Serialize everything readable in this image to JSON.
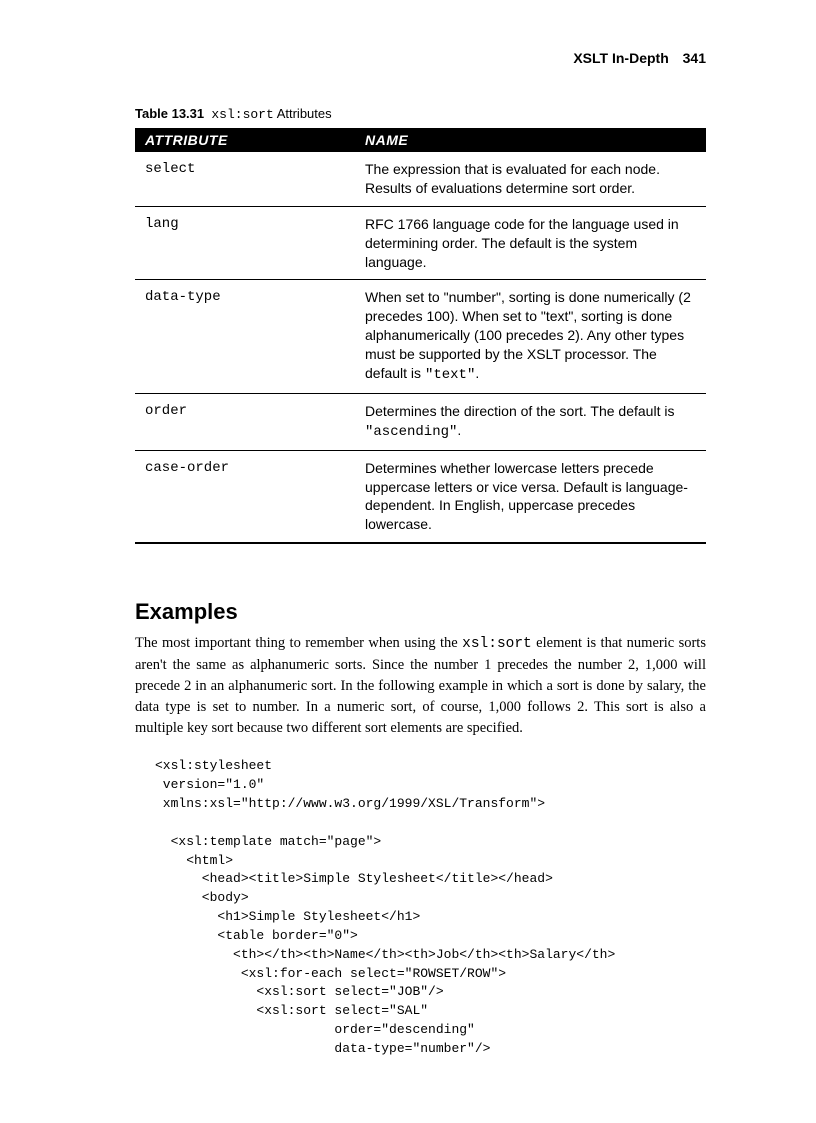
{
  "header": {
    "title": "XSLT In-Depth",
    "page_number": "341"
  },
  "table_caption": {
    "label": "Table 13.31",
    "code": "xsl:sort",
    "suffix": "Attributes"
  },
  "table": {
    "headers": {
      "col1": "ATTRIBUTE",
      "col2": "NAME"
    },
    "rows": [
      {
        "attr": "select",
        "desc": "The expression that is evaluated for each node. Results of evaluations determine sort order."
      },
      {
        "attr": "lang",
        "desc": "RFC 1766 language code for the language used in determining order. The default is the system language."
      },
      {
        "attr": "data-type",
        "desc": "When set to \"number\", sorting is done numerically (2 precedes 100). When set to \"text\", sorting is done alphanumerically (100 precedes 2). Any other types must be supported by the XSLT processor. The default is ",
        "code_suffix": "\"text\"",
        "after": "."
      },
      {
        "attr": "order",
        "desc": "Determines the direction of the sort. The default is ",
        "code_suffix": "\"ascending\"",
        "after": "."
      },
      {
        "attr": "case-order",
        "desc": "Determines whether lowercase letters precede uppercase letters or vice versa. Default is language-dependent. In English, uppercase precedes lowercase."
      }
    ]
  },
  "section_heading": "Examples",
  "paragraph": {
    "pre": "The most important thing to remember when using the ",
    "code": "xsl:sort",
    "post": " element is that numeric sorts aren't the same as alphanumeric sorts. Since the number 1 precedes the number 2, 1,000 will precede 2 in an alphanumeric sort. In the following example in which a sort is done by salary, the data type is set to number. In a numeric sort, of course, 1,000 follows 2. This sort is also a multiple key sort because two different sort elements are specified."
  },
  "code_block": "<xsl:stylesheet\n version=\"1.0\"\n xmlns:xsl=\"http://www.w3.org/1999/XSL/Transform\">\n\n  <xsl:template match=\"page\">\n    <html>\n      <head><title>Simple Stylesheet</title></head>\n      <body>\n        <h1>Simple Stylesheet</h1>\n        <table border=\"0\">\n          <th></th><th>Name</th><th>Job</th><th>Salary</th>\n           <xsl:for-each select=\"ROWSET/ROW\">\n             <xsl:sort select=\"JOB\"/>\n             <xsl:sort select=\"SAL\"\n                       order=\"descending\"\n                       data-type=\"number\"/>"
}
